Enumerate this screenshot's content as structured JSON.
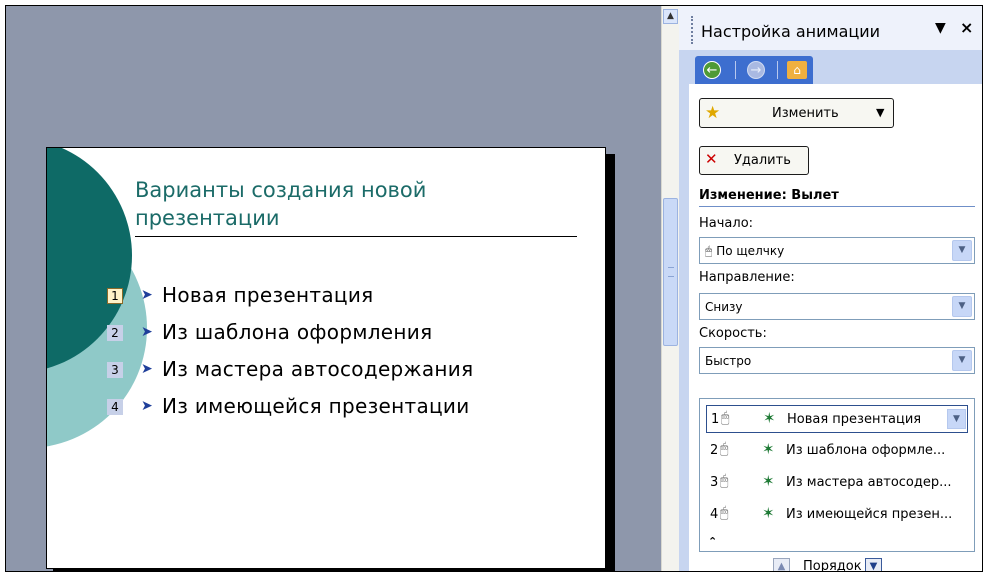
{
  "slide": {
    "title": "Варианты создания новой презентации",
    "bullets": [
      {
        "num": "1",
        "text": "Новая презентация"
      },
      {
        "num": "2",
        "text": "Из шаблона оформления"
      },
      {
        "num": "3",
        "text": "Из мастера автосодержания"
      },
      {
        "num": "4",
        "text": "Из имеющейся презентации"
      }
    ],
    "bullet_glyph": "➤"
  },
  "pane": {
    "title": "Настройка анимации",
    "menu_glyph": "▼",
    "close_glyph": "×",
    "change_button": "Изменить",
    "delete_button": "Удалить",
    "section": "Изменение: Вылет",
    "start_label": "Начало:",
    "start_value": "По щелчку",
    "direction_label": "Направление:",
    "direction_value": "Снизу",
    "speed_label": "Скорость:",
    "speed_value": "Быстро",
    "list": [
      {
        "n": "1",
        "text": "Новая презентация"
      },
      {
        "n": "2",
        "text": "Из шаблона оформле..."
      },
      {
        "n": "3",
        "text": "Из мастера автосодер..."
      },
      {
        "n": "4",
        "text": "Из имеющейся презен..."
      }
    ],
    "order_label": "Порядок"
  },
  "icons": [
    "back-icon",
    "forward-icon",
    "home-icon",
    "star-change-icon",
    "delete-icon",
    "mouse-icon",
    "animation-star-icon",
    "dropdown-arrow-icon",
    "scroll-up-icon",
    "expand-icon",
    "order-up-icon",
    "order-down-icon"
  ],
  "colors": {
    "slide_title": "#1b6b68",
    "pane_nav": "#3d6ecf",
    "workspace": "#8e97ab"
  }
}
